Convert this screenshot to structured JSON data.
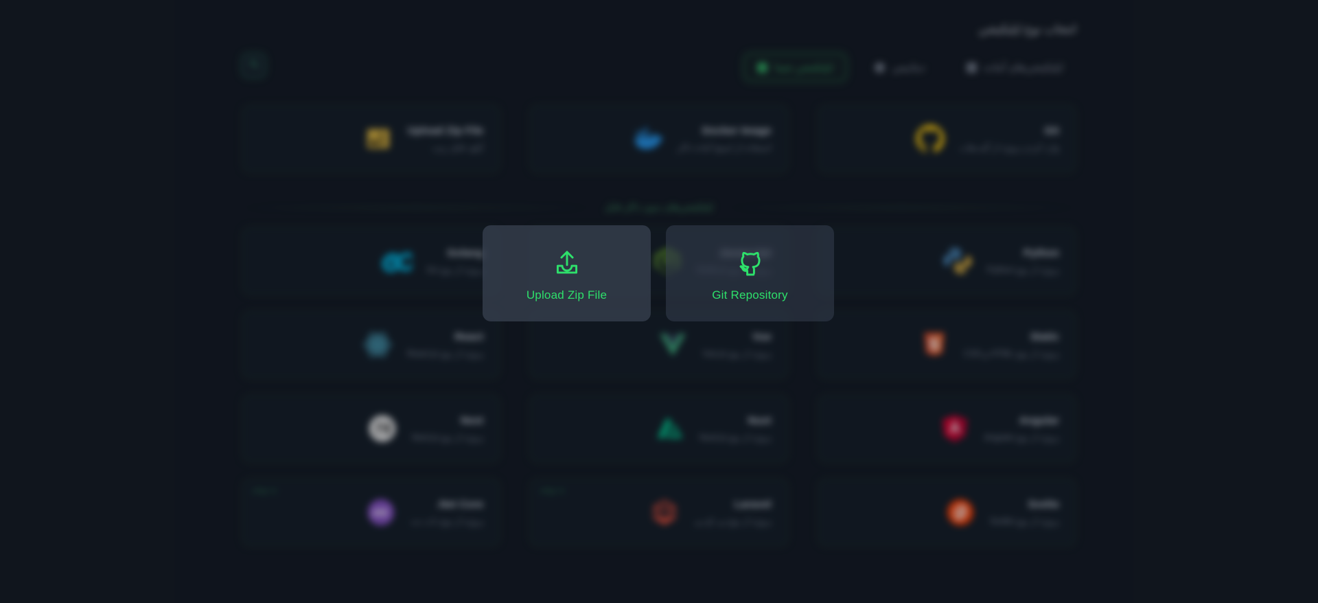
{
  "header": {
    "title": "انتخاب نوع اپلیکیشن"
  },
  "search": {
    "icon": "search-icon"
  },
  "tabs": [
    {
      "label": "اپلیکیشن‌های آماده",
      "icon": "grid-icon",
      "active": false
    },
    {
      "label": "دیتابیس",
      "icon": "database-icon",
      "active": false
    },
    {
      "label": "اپلیکیشن شما",
      "icon": "app-icon",
      "active": true
    }
  ],
  "sources": [
    {
      "title": "Git",
      "subtitle": "وارد کردن پروژه از گیت‌هاب",
      "icon": "github-icon",
      "color": "#e3b711"
    },
    {
      "title": "Docker Image",
      "subtitle": "استفاده از ایمیج آماده داکر",
      "icon": "docker-icon",
      "color": "#2496ed"
    },
    {
      "title": "Upload Zip File",
      "subtitle": "آپلود فایل زیپ",
      "icon": "zipfile-icon",
      "color": "#d8b13d"
    }
  ],
  "divider": {
    "label": "اپلیکیشن‌های بدون داکر فایل"
  },
  "frameworks": [
    {
      "title": "Python",
      "subtitle": "پروژه از نوع Python",
      "icon": "python-icon",
      "color": "#4b8bbe",
      "badge": ""
    },
    {
      "title": "Javascript",
      "subtitle": "پروژه از نوع Node.js",
      "icon": "nodejs-icon",
      "color": "#83cd29",
      "badge": ""
    },
    {
      "title": "Golang",
      "subtitle": "پروژه از نوع Go",
      "icon": "golang-icon",
      "color": "#00add8",
      "badge": ""
    },
    {
      "title": "Static",
      "subtitle": "پروژه از نوع HTML و CSS",
      "icon": "html5-icon",
      "color": "#e44d26",
      "badge": ""
    },
    {
      "title": "Vue",
      "subtitle": "پروژه از نوع Vue.js",
      "icon": "vue-icon",
      "color": "#42b883",
      "badge": ""
    },
    {
      "title": "React",
      "subtitle": "پروژه از نوع React.js",
      "icon": "react-icon",
      "color": "#61dafb",
      "badge": ""
    },
    {
      "title": "Angular",
      "subtitle": "پروژه از نوع Angular",
      "icon": "angular-icon",
      "color": "#dd0031",
      "badge": ""
    },
    {
      "title": "Nuxt",
      "subtitle": "پروژه از نوع Nuxt.js",
      "icon": "nuxt-icon",
      "color": "#00c58e",
      "badge": ""
    },
    {
      "title": "Next",
      "subtitle": "پروژه از نوع Next.js",
      "icon": "nextjs-icon",
      "color": "#e6e6e6",
      "badge": ""
    },
    {
      "title": "Svelte",
      "subtitle": "پروژه از نوع Svelte",
      "icon": "svelte-icon",
      "color": "#ff3e00",
      "badge": ""
    },
    {
      "title": "Laravel",
      "subtitle": "پروژه از نوع پی اچ پی",
      "icon": "laravel-icon",
      "color": "#d64a38",
      "badge": "به زودی"
    },
    {
      "title": "Net Core.",
      "subtitle": "پروژه از نوع دات نت",
      "icon": "dotnet-icon",
      "color": "#8a52c9",
      "badge": "به زودی"
    }
  ],
  "modal": {
    "options": [
      {
        "label": "Upload Zip File",
        "icon": "upload-icon",
        "hovered": true
      },
      {
        "label": "Git Repository",
        "icon": "github-outline-icon",
        "hovered": false
      }
    ]
  },
  "colors": {
    "background": "#121821",
    "accent_green": "#2ee06b",
    "card_border": "#1e3a2b",
    "card_bg": "#131c26",
    "title_text": "#cfd6e0",
    "sub_text": "#7e8796"
  }
}
